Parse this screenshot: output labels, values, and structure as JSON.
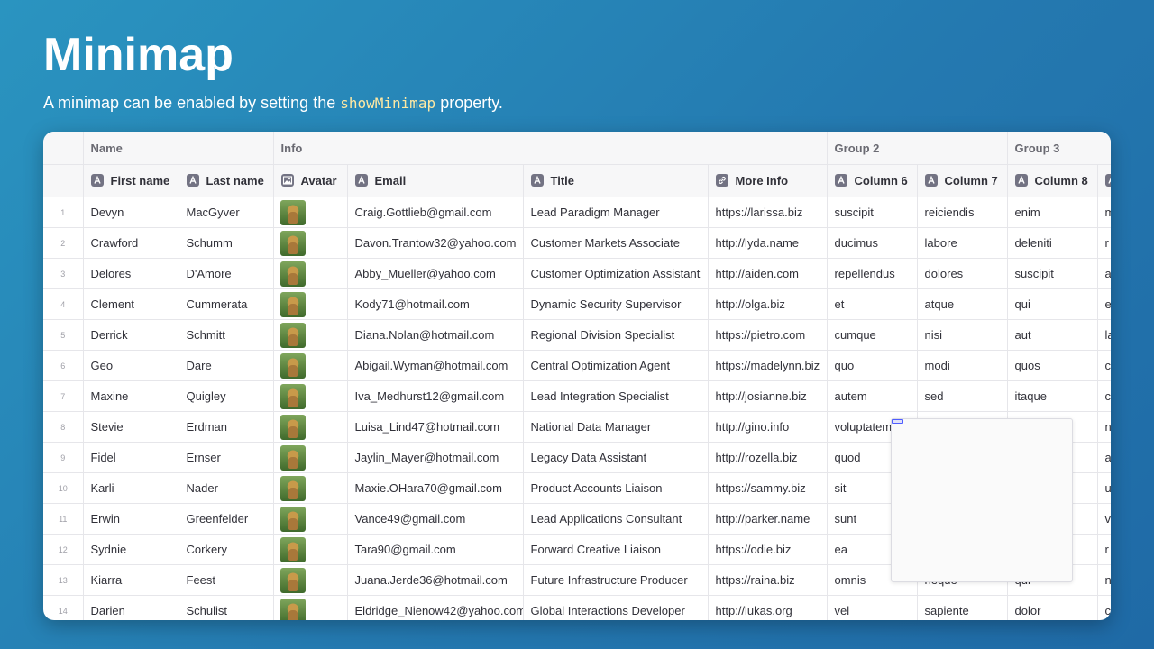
{
  "page": {
    "title": "Minimap",
    "subtitle_before": "A minimap can be enabled by setting the ",
    "subtitle_code": "showMinimap",
    "subtitle_after": " property."
  },
  "grid": {
    "groups": [
      "Name",
      "Info",
      "Group 2",
      "Group 3"
    ],
    "columns": [
      {
        "label": "First name",
        "icon": "text-icon"
      },
      {
        "label": "Last name",
        "icon": "text-icon"
      },
      {
        "label": "Avatar",
        "icon": "image-icon"
      },
      {
        "label": "Email",
        "icon": "text-icon"
      },
      {
        "label": "Title",
        "icon": "text-icon"
      },
      {
        "label": "More Info",
        "icon": "link-icon"
      },
      {
        "label": "Column 6",
        "icon": "text-icon"
      },
      {
        "label": "Column 7",
        "icon": "text-icon"
      },
      {
        "label": "Column 8",
        "icon": "text-icon"
      }
    ],
    "rows": [
      {
        "n": "1",
        "first": "Devyn",
        "last": "MacGyver",
        "email": "Craig.Gottlieb@gmail.com",
        "title": "Lead Paradigm Manager",
        "more": "https://larissa.biz",
        "c6": "suscipit",
        "c7": "reiciendis",
        "c8": "enim",
        "c9": "m"
      },
      {
        "n": "2",
        "first": "Crawford",
        "last": "Schumm",
        "email": "Davon.Trantow32@yahoo.com",
        "title": "Customer Markets Associate",
        "more": "http://lyda.name",
        "c6": "ducimus",
        "c7": "labore",
        "c8": "deleniti",
        "c9": "r"
      },
      {
        "n": "3",
        "first": "Delores",
        "last": "D'Amore",
        "email": "Abby_Mueller@yahoo.com",
        "title": "Customer Optimization Assistant",
        "more": "http://aiden.com",
        "c6": "repellendus",
        "c7": "dolores",
        "c8": "suscipit",
        "c9": "a"
      },
      {
        "n": "4",
        "first": "Clement",
        "last": "Cummerata",
        "email": "Kody71@hotmail.com",
        "title": "Dynamic Security Supervisor",
        "more": "http://olga.biz",
        "c6": "et",
        "c7": "atque",
        "c8": "qui",
        "c9": "e"
      },
      {
        "n": "5",
        "first": "Derrick",
        "last": "Schmitt",
        "email": "Diana.Nolan@hotmail.com",
        "title": "Regional Division Specialist",
        "more": "https://pietro.com",
        "c6": "cumque",
        "c7": "nisi",
        "c8": "aut",
        "c9": "la"
      },
      {
        "n": "6",
        "first": "Geo",
        "last": "Dare",
        "email": "Abigail.Wyman@hotmail.com",
        "title": "Central Optimization Agent",
        "more": "https://madelynn.biz",
        "c6": "quo",
        "c7": "modi",
        "c8": "quos",
        "c9": "c"
      },
      {
        "n": "7",
        "first": "Maxine",
        "last": "Quigley",
        "email": "Iva_Medhurst12@gmail.com",
        "title": "Lead Integration Specialist",
        "more": "http://josianne.biz",
        "c6": "autem",
        "c7": "sed",
        "c8": "itaque",
        "c9": "c"
      },
      {
        "n": "8",
        "first": "Stevie",
        "last": "Erdman",
        "email": "Luisa_Lind47@hotmail.com",
        "title": "National Data Manager",
        "more": "http://gino.info",
        "c6": "voluptatem",
        "c7": "",
        "c8": "",
        "c9": "n"
      },
      {
        "n": "9",
        "first": "Fidel",
        "last": "Ernser",
        "email": "Jaylin_Mayer@hotmail.com",
        "title": "Legacy Data Assistant",
        "more": "http://rozella.biz",
        "c6": "quod",
        "c7": "",
        "c8": "",
        "c9": "a"
      },
      {
        "n": "10",
        "first": "Karli",
        "last": "Nader",
        "email": "Maxie.OHara70@gmail.com",
        "title": "Product Accounts Liaison",
        "more": "https://sammy.biz",
        "c6": "sit",
        "c7": "",
        "c8": "",
        "c9": "u"
      },
      {
        "n": "11",
        "first": "Erwin",
        "last": "Greenfelder",
        "email": "Vance49@gmail.com",
        "title": "Lead Applications Consultant",
        "more": "http://parker.name",
        "c6": "sunt",
        "c7": "",
        "c8": "",
        "c9": "v"
      },
      {
        "n": "12",
        "first": "Sydnie",
        "last": "Corkery",
        "email": "Tara90@gmail.com",
        "title": "Forward Creative Liaison",
        "more": "https://odie.biz",
        "c6": "ea",
        "c7": "",
        "c8": "",
        "c9": "r"
      },
      {
        "n": "13",
        "first": "Kiarra",
        "last": "Feest",
        "email": "Juana.Jerde36@hotmail.com",
        "title": "Future Infrastructure Producer",
        "more": "https://raina.biz",
        "c6": "omnis",
        "c7": "neque",
        "c8": "qui",
        "c9": "n"
      },
      {
        "n": "14",
        "first": "Darien",
        "last": "Schulist",
        "email": "Eldridge_Nienow42@yahoo.com",
        "title": "Global Interactions Developer",
        "more": "http://lukas.org",
        "c6": "vel",
        "c7": "sapiente",
        "c8": "dolor",
        "c9": "c"
      }
    ]
  }
}
